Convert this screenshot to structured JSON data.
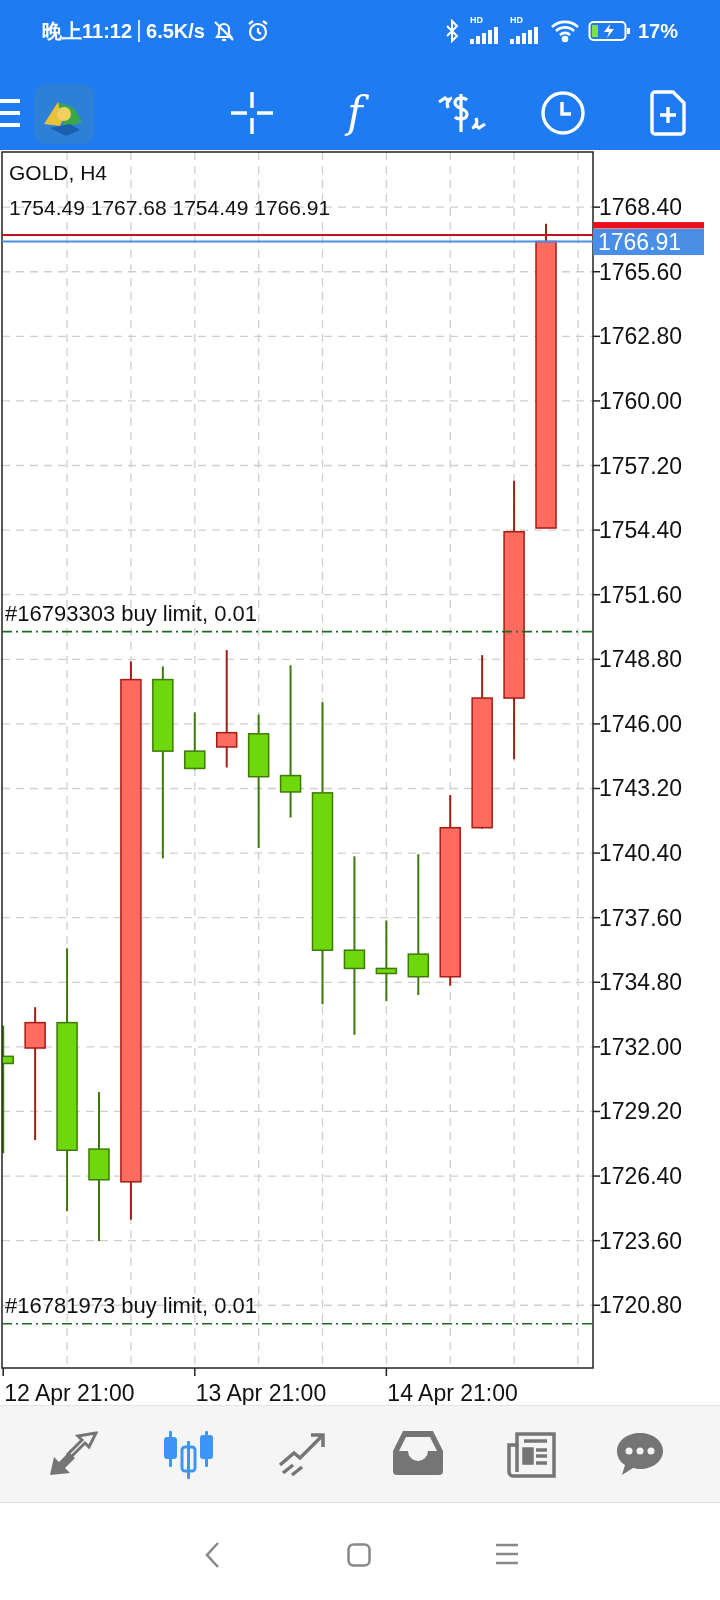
{
  "status_bar": {
    "time": "晚上11:12",
    "speed": "6.5K/s",
    "battery": "17%",
    "signal_labels": [
      "HD",
      "HD"
    ]
  },
  "toolbar": {
    "items": [
      {
        "kind": "crosshair"
      },
      {
        "kind": "indicators",
        "text": "f"
      },
      {
        "kind": "trade"
      },
      {
        "kind": "timeframe"
      },
      {
        "kind": "new"
      }
    ]
  },
  "chart": {
    "symbol": "GOLD, H4",
    "ohlc": "1754.49 1767.68 1754.49 1766.91",
    "price_labels": [
      "1768.40",
      "1765.60",
      "1762.80",
      "1760.00",
      "1757.20",
      "1754.40",
      "1751.60",
      "1748.80",
      "1746.00",
      "1743.20",
      "1740.40",
      "1737.60",
      "1734.80",
      "1732.00",
      "1729.20",
      "1726.40",
      "1723.60",
      "1720.80"
    ],
    "time_labels": [
      "12 Apr 21:00",
      "13 Apr 21:00",
      "14 Apr 21:00"
    ],
    "orders": [
      {
        "label": "#16793303 buy limit, 0.01"
      },
      {
        "label": "#16781973 buy limit, 0.01"
      }
    ],
    "bid_label": "1766.91"
  },
  "bottom_nav": [
    {
      "kind": "quotes",
      "selected": false
    },
    {
      "kind": "chart",
      "selected": true
    },
    {
      "kind": "trade",
      "selected": false
    },
    {
      "kind": "history",
      "selected": false
    },
    {
      "kind": "news",
      "selected": false
    },
    {
      "kind": "chat",
      "selected": false
    }
  ]
}
